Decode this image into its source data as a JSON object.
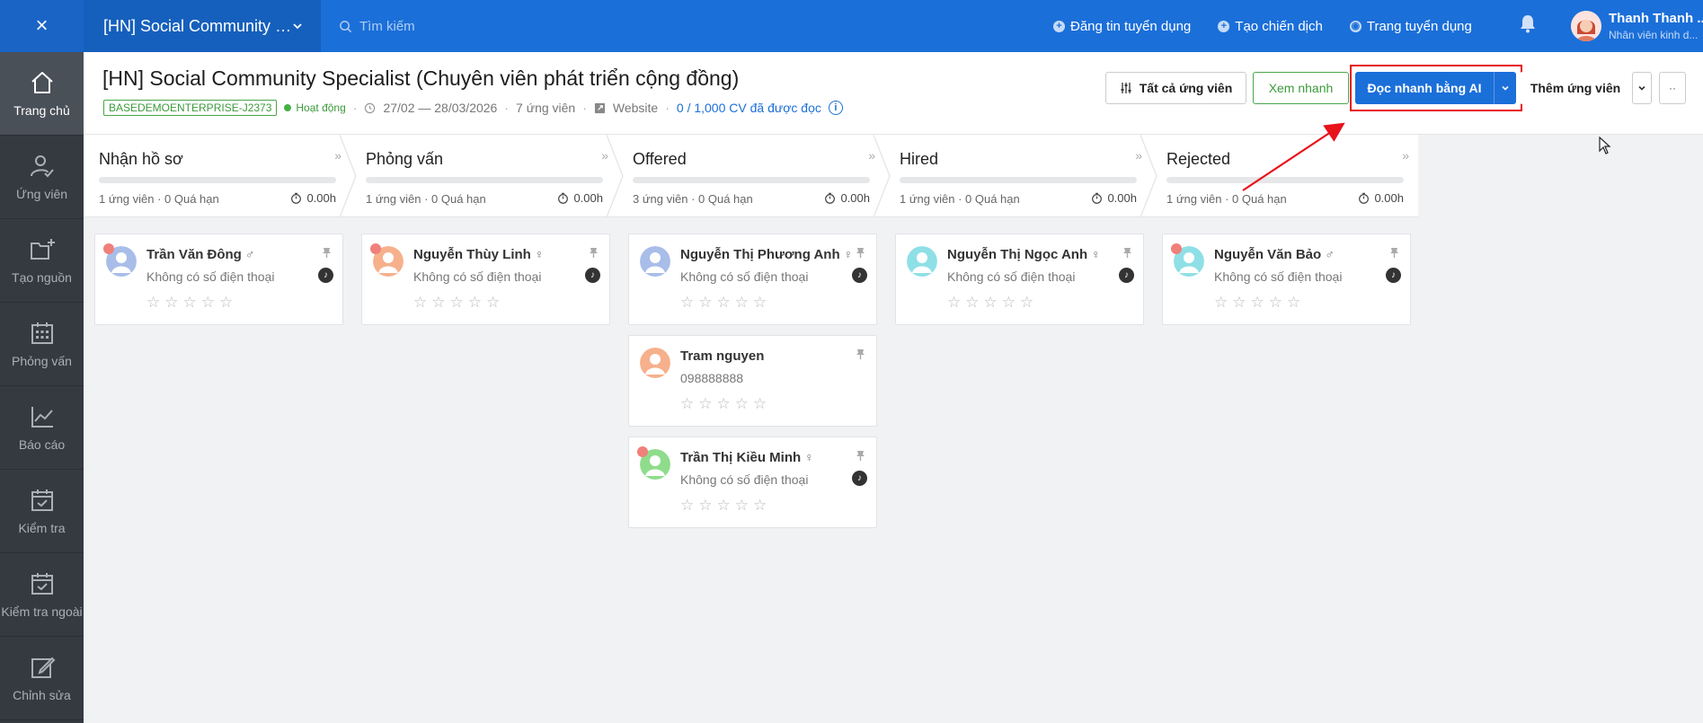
{
  "topbar": {
    "close_label": "×",
    "job_selector": "[HN] Social Community Sp...",
    "search_placeholder": "Tìm kiếm",
    "links": [
      "Đăng tin tuyển dụng",
      "Tạo chiến dịch",
      "Trang tuyển dụng"
    ],
    "user_name": "Thanh Thanh ...",
    "user_role": "Nhân viên kinh d..."
  },
  "sidebar": {
    "items": [
      {
        "label": "Trang chủ",
        "icon": "home-icon",
        "active": true
      },
      {
        "label": "Ứng viên",
        "icon": "user-check-icon"
      },
      {
        "label": "Tạo nguồn",
        "icon": "folder-plus-icon"
      },
      {
        "label": "Phỏng vấn",
        "icon": "calendar-grid-icon"
      },
      {
        "label": "Báo cáo",
        "icon": "chart-line-icon"
      },
      {
        "label": "Kiểm tra",
        "icon": "calendar-check-icon"
      },
      {
        "label": "Kiểm tra ngoài",
        "icon": "calendar-check-outline-icon"
      },
      {
        "label": "Chỉnh sửa",
        "icon": "edit-icon"
      }
    ]
  },
  "header": {
    "title": "[HN] Social Community Specialist (Chuyên viên phát triển cộng đồng)",
    "code": "BASEDEMOENTERPRISE-J2373",
    "status": "Hoạt động",
    "date_range": "27/02 — 28/03/2026",
    "candidates": "7 ứng viên",
    "source": "Website",
    "cv_read": "0 / 1,000 CV đã được đọc",
    "btn_all": "Tất cả ứng viên",
    "btn_quick": "Xem nhanh",
    "btn_ai": "Đọc nhanh bằng AI",
    "btn_add": "Thêm ứng viên",
    "btn_more": "··"
  },
  "stages": [
    {
      "name": "Nhận hồ sơ",
      "info": "1 ứng viên · 0 Quá hạn",
      "time": "0.00h"
    },
    {
      "name": "Phỏng vấn",
      "info": "1 ứng viên · 0 Quá hạn",
      "time": "0.00h"
    },
    {
      "name": "Offered",
      "info": "3 ứng viên · 0 Quá hạn",
      "time": "0.00h"
    },
    {
      "name": "Hired",
      "info": "1 ứng viên · 0 Quá hạn",
      "time": "0.00h"
    },
    {
      "name": "Rejected",
      "info": "1 ứng viên · 0 Quá hạn",
      "time": "0.00h"
    }
  ],
  "columns": [
    [
      {
        "name": "Trần Văn Đông",
        "gender": "♂",
        "phone": "Không có số điện thoại",
        "avatar_color": "#a8bde8",
        "new": true,
        "badge": true
      }
    ],
    [
      {
        "name": "Nguyễn Thùy Linh",
        "gender": "♀",
        "phone": "Không có số điện thoại",
        "avatar_color": "#f6b08c",
        "new": true,
        "badge": true
      }
    ],
    [
      {
        "name": "Nguyễn Thị Phương Anh",
        "gender": "♀",
        "phone": "Không có số điện thoại",
        "avatar_color": "#a8bde8",
        "new": false,
        "badge": true
      },
      {
        "name": "Tram nguyen",
        "gender": "",
        "phone": "098888888",
        "avatar_color": "#f6b08c",
        "new": false,
        "badge": false
      },
      {
        "name": "Trần Thị Kiều Minh",
        "gender": "♀",
        "phone": "Không có số điện thoại",
        "avatar_color": "#8fdc8c",
        "new": true,
        "badge": true
      }
    ],
    [
      {
        "name": "Nguyễn Thị Ngọc Anh",
        "gender": "♀",
        "phone": "Không có số điện thoại",
        "avatar_color": "#8ee0e6",
        "new": false,
        "badge": true
      }
    ],
    [
      {
        "name": "Nguyễn Văn Bảo",
        "gender": "♂",
        "phone": "Không có số điện thoại",
        "avatar_color": "#8ee0e6",
        "new": true,
        "badge": true
      }
    ]
  ],
  "colors": {
    "primary": "#1b6fd9",
    "success": "#3b9a3b",
    "highlight": "#e8121a",
    "sidebar": "#353a40"
  }
}
